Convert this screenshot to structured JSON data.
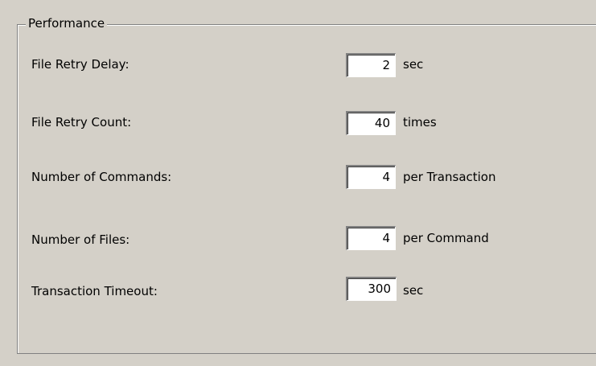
{
  "group": {
    "title": "Performance"
  },
  "rows": [
    {
      "label": "File Retry Delay:",
      "value": "2",
      "unit": "sec"
    },
    {
      "label": "File Retry Count:",
      "value": "40",
      "unit": "times"
    },
    {
      "label": "Number of Commands:",
      "value": "4",
      "unit": "per Transaction"
    },
    {
      "label": "Number of Files:",
      "value": "4",
      "unit": "per Command"
    },
    {
      "label": "Transaction Timeout:",
      "value": "300",
      "unit": "sec"
    }
  ]
}
